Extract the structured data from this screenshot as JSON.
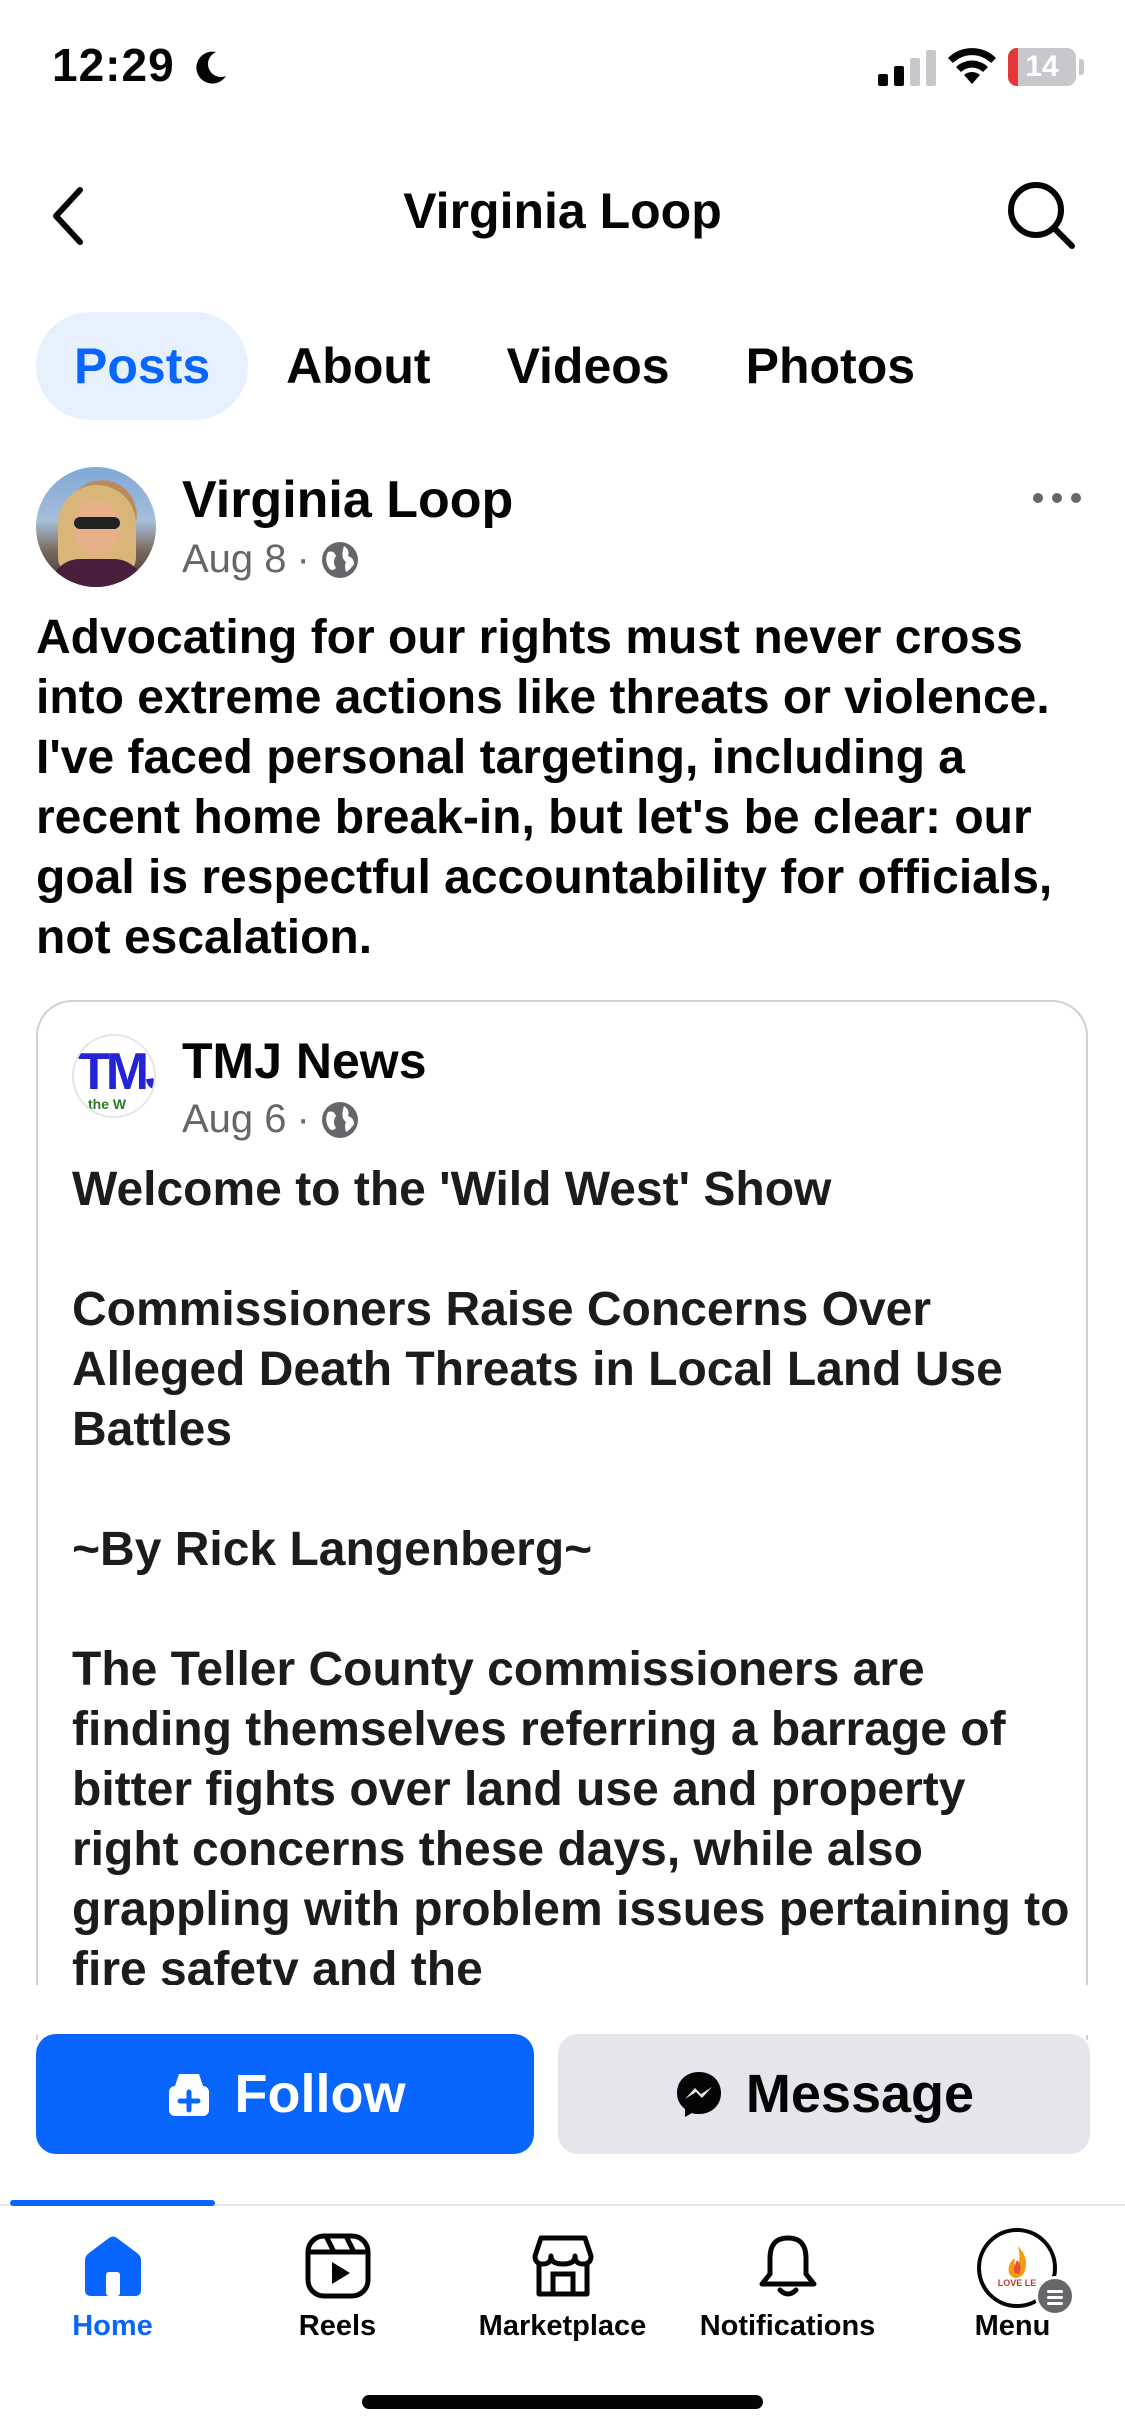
{
  "status_bar": {
    "time": "12:29",
    "battery": "14",
    "battery_level": 0.14,
    "icons": [
      "moon-icon",
      "signal-icon",
      "wifi-icon",
      "battery-icon"
    ]
  },
  "header": {
    "title": "Virginia Loop"
  },
  "tabs": [
    {
      "label": "Posts",
      "active": true
    },
    {
      "label": "About",
      "active": false
    },
    {
      "label": "Videos",
      "active": false
    },
    {
      "label": "Photos",
      "active": false
    }
  ],
  "post": {
    "author": "Virginia Loop",
    "date": "Aug 8",
    "separator": "·",
    "text": "Advocating for our rights must never cross into extreme actions like threats or violence. I've faced personal targeting, including a recent home break-in, but let's be clear: our goal is respectful accountability for officials, not escalation.",
    "shared": {
      "author": "TMJ News",
      "logo_text": "TMJ",
      "logo_subtext": "the W",
      "date": "Aug 6",
      "separator": "·",
      "paragraphs": [
        "Welcome to the 'Wild West' Show",
        "Commissioners Raise Concerns Over Alleged Death Threats in Local Land Use Battles",
        "~By Rick Langenberg~",
        "The Teller County commissioners are finding themselves referring a barrage of bitter fights over land use and property right concerns these days, while also grappling with problem issues pertaining to fire safety and the"
      ]
    }
  },
  "actions": {
    "follow_label": "Follow",
    "message_label": "Message"
  },
  "bottom_nav": [
    {
      "label": "Home",
      "icon": "home-icon",
      "active": true
    },
    {
      "label": "Reels",
      "icon": "reels-icon",
      "active": false
    },
    {
      "label": "Marketplace",
      "icon": "marketplace-icon",
      "active": false
    },
    {
      "label": "Notifications",
      "icon": "bell-icon",
      "active": false
    },
    {
      "label": "Menu",
      "icon": "menu-avatar",
      "active": false
    }
  ],
  "menu_avatar_text": "LOVE LE",
  "colors": {
    "accent": "#0866ff",
    "tab_active_bg": "#e7f0fd",
    "secondary_button": "#e4e6eb",
    "meta_text": "#65676b"
  }
}
